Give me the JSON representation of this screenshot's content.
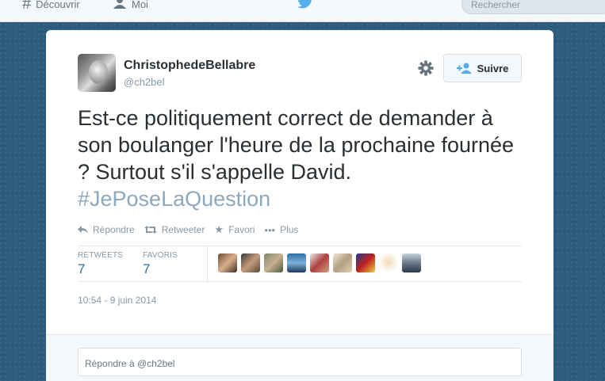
{
  "topbar": {
    "nav": [
      {
        "label": "Découvrir",
        "icon": "hash-icon"
      },
      {
        "label": "Moi",
        "icon": "person-icon"
      }
    ],
    "search_placeholder": "Rechercher"
  },
  "tweet": {
    "fullname": "ChristophedeBellabre",
    "handle": "@ch2bel",
    "follow_label": "Suivre",
    "text": "Est-ce politiquement correct de demander à son boulanger l'heure de la prochaine fournée ? Surtout s'il s'appelle David.",
    "hashtag": "#JePoseLaQuestion",
    "actions": [
      {
        "label": "Répondre",
        "icon": "reply-icon"
      },
      {
        "label": "Retweeter",
        "icon": "retweet-icon"
      },
      {
        "label": "Favori",
        "icon": "star-icon"
      },
      {
        "label": "Plus",
        "icon": "more-icon"
      }
    ],
    "stats": {
      "retweets_label": "RETWEETS",
      "retweets": "7",
      "favorites_label": "FAVORIS",
      "favorites": "7"
    },
    "timestamp": "10:54 - 9 juin 2014"
  },
  "reply": {
    "placeholder": "Répondre à @ch2bel"
  },
  "colors": {
    "accent": "#2f6fa0",
    "hashtag": "#8ea8bd",
    "background": "#2d5b7e"
  }
}
